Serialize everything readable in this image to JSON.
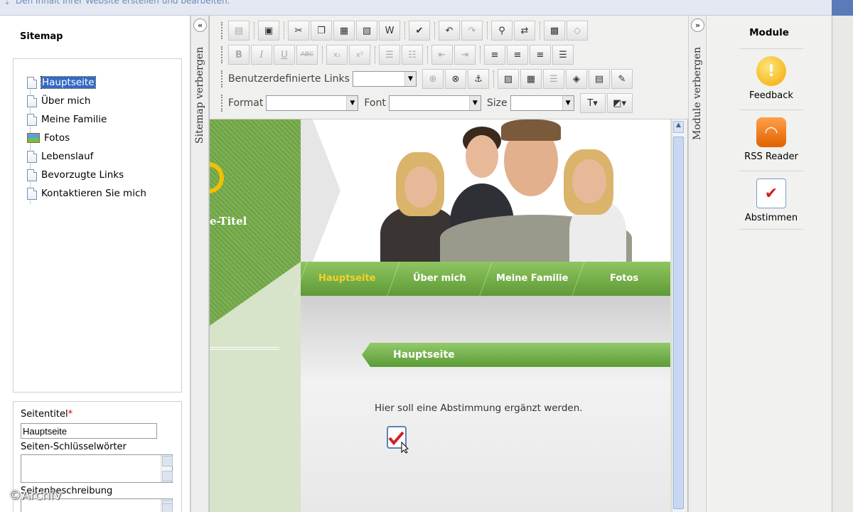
{
  "top_hint": "Den Inhalt Ihrer Website erstellen und bearbeiten.",
  "sitemap": {
    "title": "Sitemap",
    "collapse_label": "Sitemap verbergen",
    "items": [
      {
        "label": "Hauptseite",
        "icon": "page-icon",
        "selected": true
      },
      {
        "label": "Über mich",
        "icon": "page-icon"
      },
      {
        "label": "Meine Familie",
        "icon": "page-icon"
      },
      {
        "label": "Fotos",
        "icon": "image-icon"
      },
      {
        "label": "Lebenslauf",
        "icon": "page-icon"
      },
      {
        "label": "Bevorzugte Links",
        "icon": "page-icon"
      },
      {
        "label": "Kontaktieren Sie mich",
        "icon": "page-icon"
      }
    ]
  },
  "properties": {
    "page_title_label": "Seitentitel",
    "required_marker": "*",
    "page_title_value": "Hauptseite",
    "keywords_label": "Seiten-Schlüsselwörter",
    "description_label": "Seitenbeschreibung"
  },
  "toolbar": {
    "links_label": "Benutzerdefinierte Links",
    "format_label": "Format",
    "font_label": "Font",
    "size_label": "Size",
    "row1_icons": [
      "paste-icon",
      "save-icon",
      "cut-icon",
      "copy-icon",
      "paste-plain-icon",
      "paste-text-icon",
      "paste-word-icon",
      "spellcheck-icon",
      "undo-icon",
      "redo-icon",
      "find-icon",
      "replace-icon",
      "select-all-icon",
      "eraser-icon"
    ],
    "row2_icons": [
      "bold-icon",
      "italic-icon",
      "underline-icon",
      "strikethrough-icon",
      "subscript-icon",
      "superscript-icon",
      "ordered-list-icon",
      "unordered-list-icon",
      "outdent-icon",
      "indent-icon",
      "align-left-icon",
      "align-center-icon",
      "align-right-icon",
      "align-justify-icon"
    ],
    "row3_icons": [
      "link-icon",
      "unlink-icon",
      "anchor-icon",
      "image-icon",
      "table-icon",
      "rule-icon",
      "special-char-icon",
      "form-icon",
      "template-icon"
    ]
  },
  "site": {
    "title_fragment": "e-Titel",
    "nav": [
      {
        "label": "Hauptseite",
        "active": true
      },
      {
        "label": "Über mich"
      },
      {
        "label": "Meine Familie"
      },
      {
        "label": "Fotos"
      }
    ],
    "content_heading": "Hauptseite",
    "content_text": "Hier soll eine Abstimmung ergänzt werden."
  },
  "modules": {
    "title": "Module",
    "collapse_label": "Module verbergen",
    "items": [
      {
        "label": "Feedback",
        "icon": "feedback-icon"
      },
      {
        "label": "RSS Reader",
        "icon": "rss-icon"
      },
      {
        "label": "Abstimmen",
        "icon": "vote-icon"
      }
    ]
  },
  "watermark": "©Archiv",
  "colors": {
    "selection": "#316ac5",
    "nav_green": "#6aa640",
    "nav_active": "#f4d12a"
  }
}
